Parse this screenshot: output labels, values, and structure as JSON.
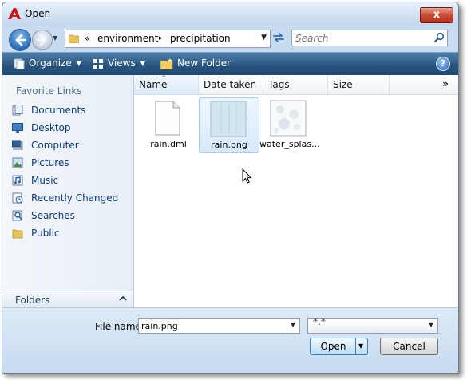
{
  "window": {
    "title": "Open",
    "close_label": "x"
  },
  "address": {
    "overflow": "«",
    "crumbs": [
      "environment",
      "precipitation"
    ],
    "separator": "▸"
  },
  "search": {
    "placeholder": "Search"
  },
  "toolbar": {
    "organize": "Organize",
    "views": "Views",
    "new_folder": "New Folder",
    "help": "?"
  },
  "sidebar": {
    "title": "Favorite Links",
    "items": [
      {
        "label": "Documents",
        "icon": "documents-icon"
      },
      {
        "label": "Desktop",
        "icon": "desktop-icon"
      },
      {
        "label": "Computer",
        "icon": "computer-icon"
      },
      {
        "label": "Pictures",
        "icon": "pictures-icon"
      },
      {
        "label": "Music",
        "icon": "music-icon"
      },
      {
        "label": "Recently Changed",
        "icon": "recently-changed-icon"
      },
      {
        "label": "Searches",
        "icon": "searches-icon"
      },
      {
        "label": "Public",
        "icon": "public-folder-icon"
      }
    ],
    "folders_label": "Folders"
  },
  "columns": {
    "name": "Name",
    "date_taken": "Date taken",
    "tags": "Tags",
    "size": "Size",
    "more": "»"
  },
  "files": [
    {
      "label": "rain.dml",
      "selected": false
    },
    {
      "label": "rain.png",
      "selected": true
    },
    {
      "label": "water_splas...",
      "selected": false
    }
  ],
  "footer": {
    "file_name_label": "File name:",
    "file_name_value": "rain.png",
    "file_type_value": "*.*",
    "open_label": "Open",
    "cancel_label": "Cancel"
  },
  "colors": {
    "toolbar": "#27547e",
    "link_text": "#0d3c7a",
    "selection": "#d8e9fb"
  }
}
